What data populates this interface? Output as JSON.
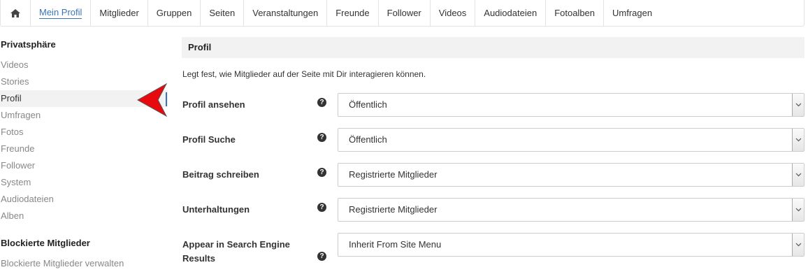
{
  "nav": {
    "home_icon": "home-icon",
    "items": [
      {
        "label": "Mein Profil",
        "active": true
      },
      {
        "label": "Mitglieder"
      },
      {
        "label": "Gruppen"
      },
      {
        "label": "Seiten"
      },
      {
        "label": "Veranstaltungen"
      },
      {
        "label": "Freunde"
      },
      {
        "label": "Follower"
      },
      {
        "label": "Videos"
      },
      {
        "label": "Audiodateien"
      },
      {
        "label": "Fotoalben"
      },
      {
        "label": "Umfragen"
      }
    ]
  },
  "sidebar": {
    "privacy_heading": "Privatsphäre",
    "items": [
      {
        "label": "Videos"
      },
      {
        "label": "Stories"
      },
      {
        "label": "Profil",
        "active": true
      },
      {
        "label": "Umfragen"
      },
      {
        "label": "Fotos"
      },
      {
        "label": "Freunde"
      },
      {
        "label": "Follower"
      },
      {
        "label": "System"
      },
      {
        "label": "Audiodateien"
      },
      {
        "label": "Alben"
      }
    ],
    "blocked_heading": "Blockierte Mitglieder",
    "blocked_link": "Blockierte Mitglieder verwalten"
  },
  "main": {
    "section_title": "Profil",
    "description": "Legt fest, wie Mitglieder auf der Seite mit Dir interagieren können.",
    "help_glyph": "?",
    "settings": [
      {
        "label": "Profil ansehen",
        "value": "Öffentlich"
      },
      {
        "label": "Profil Suche",
        "value": "Öffentlich"
      },
      {
        "label": "Beitrag schreiben",
        "value": "Registrierte Mitglieder"
      },
      {
        "label": "Unterhaltungen",
        "value": "Registrierte Mitglieder"
      },
      {
        "label": "Appear in Search Engine Results",
        "value": "Inherit From Site Menu"
      }
    ]
  },
  "colors": {
    "accent": "#3b73b9",
    "arrow": "#e8090f"
  }
}
